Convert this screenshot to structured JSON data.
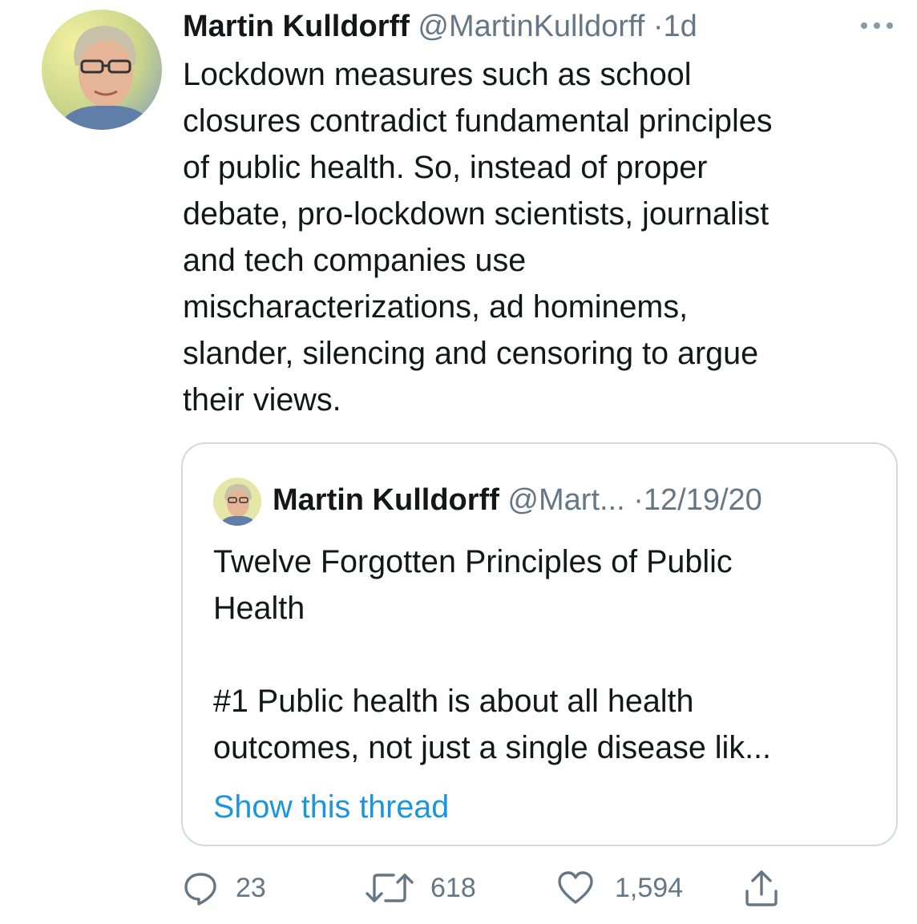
{
  "tweet": {
    "author_name": "Martin Kulldorff",
    "handle": "@MartinKulldorff",
    "separator": "·",
    "time": "1d",
    "text": "Lockdown measures such as school\nclosures contradict fundamental principles\nof public health. So, instead of proper\ndebate, pro-lockdown scientists, journalist\nand tech companies use\nmischaracterizations, ad hominems,\nslander, silencing and censoring to argue\ntheir views.",
    "avatar_icon": "profile-photo",
    "more_icon": "more-horizontal-icon"
  },
  "quoted": {
    "author_name": "Martin Kulldorff",
    "handle": "@Mart...",
    "separator": "·",
    "date": "12/19/20",
    "text": "Twelve Forgotten Principles of Public\nHealth\n\n#1 Public health is about all health\noutcomes, not just a single disease lik...",
    "show_thread": "Show this thread"
  },
  "actions": {
    "replies": "23",
    "retweets": "618",
    "likes": "1,594",
    "icons": [
      "reply-icon",
      "retweet-icon",
      "like-icon",
      "share-icon"
    ]
  },
  "colors": {
    "text": "#14171a",
    "secondary": "#657786",
    "link": "#1b95e0",
    "border": "#cfd9de"
  }
}
